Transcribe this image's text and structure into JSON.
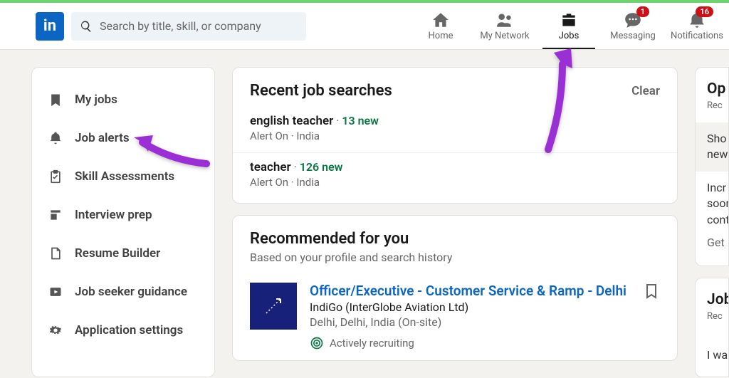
{
  "logo": "in",
  "search": {
    "placeholder": "Search by title, skill, or company"
  },
  "nav": {
    "home": "Home",
    "network": "My Network",
    "jobs": "Jobs",
    "messaging": "Messaging",
    "notifications": "Notifications",
    "badge_msg": "1",
    "badge_not": "16"
  },
  "sidebar": {
    "myjobs": "My jobs",
    "alerts": "Job alerts",
    "skill": "Skill Assessments",
    "interview": "Interview prep",
    "resume": "Resume Builder",
    "guidance": "Job seeker guidance",
    "appset": "Application settings"
  },
  "recent": {
    "title": "Recent job searches",
    "clear": "Clear",
    "rows": [
      {
        "term": "english teacher",
        "new": "13 new",
        "sub": "Alert On · India"
      },
      {
        "term": "teacher",
        "new": "126 new",
        "sub": "Alert On · India"
      }
    ]
  },
  "rec": {
    "title": "Recommended for you",
    "sub": "Based on your profile and search history",
    "job": {
      "title": "Officer/Executive - Customer Service & Ramp - Delhi",
      "company": "IndiGo (InterGlobe Aviation Ltd)",
      "loc": "Delhi, Delhi, India (On-site)",
      "recruit": "Actively recruiting"
    }
  },
  "right": {
    "open": "Op",
    "rec": "Rec",
    "show": "Sho",
    "new": "new",
    "inc": "Incr",
    "soon": "soon",
    "cont": "cont",
    "get": "Get",
    "job": "Job",
    "rec2": "Rec",
    "iwa": "I wa"
  }
}
